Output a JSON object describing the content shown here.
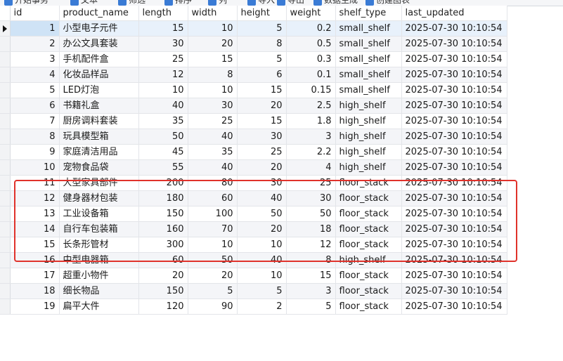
{
  "toolbar": {
    "items": [
      {
        "label": "开始事务",
        "icon": "begin-transaction-icon",
        "color": "#3a7bd5"
      },
      {
        "label": "文本",
        "icon": "text-icon",
        "color": "#3a7bd5"
      },
      {
        "label": "筛选",
        "icon": "filter-icon",
        "color": "#3a7bd5"
      },
      {
        "label": "排序",
        "icon": "sort-icon",
        "color": "#3a7bd5"
      },
      {
        "label": "列",
        "icon": "columns-icon",
        "color": "#3a7bd5"
      },
      {
        "label": "导入",
        "icon": "import-icon",
        "color": "#3a7bd5"
      },
      {
        "label": "导出",
        "icon": "export-icon",
        "color": "#3a7bd5"
      },
      {
        "label": "数据生成",
        "icon": "data-generate-icon",
        "color": "#3a7bd5"
      },
      {
        "label": "创建图表",
        "icon": "create-chart-icon",
        "color": "#3a7bd5"
      }
    ]
  },
  "grid": {
    "columns": [
      "id",
      "product_name",
      "length",
      "width",
      "height",
      "weight",
      "shelf_type",
      "last_updated"
    ],
    "rows": [
      [
        "1",
        "小型电子元件",
        "15",
        "10",
        "5",
        "0.2",
        "small_shelf",
        "2025-07-30 10:10:54"
      ],
      [
        "2",
        "办公文具套装",
        "30",
        "20",
        "8",
        "0.5",
        "small_shelf",
        "2025-07-30 10:10:54"
      ],
      [
        "3",
        "手机配件盒",
        "25",
        "15",
        "5",
        "0.3",
        "small_shelf",
        "2025-07-30 10:10:54"
      ],
      [
        "4",
        "化妆品样品",
        "12",
        "8",
        "6",
        "0.1",
        "small_shelf",
        "2025-07-30 10:10:54"
      ],
      [
        "5",
        "LED灯泡",
        "10",
        "10",
        "15",
        "0.15",
        "small_shelf",
        "2025-07-30 10:10:54"
      ],
      [
        "6",
        "书籍礼盒",
        "40",
        "30",
        "20",
        "2.5",
        "high_shelf",
        "2025-07-30 10:10:54"
      ],
      [
        "7",
        "厨房调料套装",
        "35",
        "25",
        "15",
        "1.8",
        "high_shelf",
        "2025-07-30 10:10:54"
      ],
      [
        "8",
        "玩具模型箱",
        "50",
        "40",
        "30",
        "3",
        "high_shelf",
        "2025-07-30 10:10:54"
      ],
      [
        "9",
        "家庭清洁用品",
        "45",
        "35",
        "25",
        "2.2",
        "high_shelf",
        "2025-07-30 10:10:54"
      ],
      [
        "10",
        "宠物食品袋",
        "55",
        "40",
        "20",
        "4",
        "high_shelf",
        "2025-07-30 10:10:54"
      ],
      [
        "11",
        "大型家具部件",
        "200",
        "80",
        "30",
        "25",
        "floor_stack",
        "2025-07-30 10:10:54"
      ],
      [
        "12",
        "健身器材包装",
        "180",
        "60",
        "40",
        "30",
        "floor_stack",
        "2025-07-30 10:10:54"
      ],
      [
        "13",
        "工业设备箱",
        "150",
        "100",
        "50",
        "50",
        "floor_stack",
        "2025-07-30 10:10:54"
      ],
      [
        "14",
        "自行车包装箱",
        "160",
        "70",
        "20",
        "18",
        "floor_stack",
        "2025-07-30 10:10:54"
      ],
      [
        "15",
        "长条形管材",
        "300",
        "10",
        "10",
        "12",
        "floor_stack",
        "2025-07-30 10:10:54"
      ],
      [
        "16",
        "中型电器箱",
        "60",
        "50",
        "40",
        "8",
        "high_shelf",
        "2025-07-30 10:10:54"
      ],
      [
        "17",
        "超重小物件",
        "20",
        "20",
        "10",
        "15",
        "floor_stack",
        "2025-07-30 10:10:54"
      ],
      [
        "18",
        "细长物品",
        "150",
        "5",
        "5",
        "3",
        "floor_stack",
        "2025-07-30 10:10:54"
      ],
      [
        "19",
        "扁平大件",
        "120",
        "90",
        "2",
        "5",
        "floor_stack",
        "2025-07-30 10:10:54"
      ]
    ],
    "selected_row": 0,
    "highlight_color": "#e0322b"
  }
}
